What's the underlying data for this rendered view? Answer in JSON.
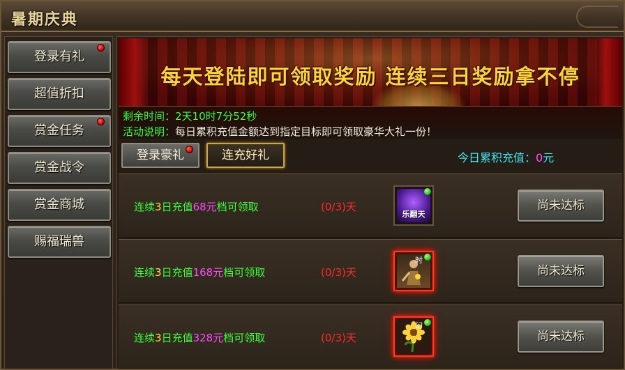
{
  "window": {
    "title": "暑期庆典"
  },
  "sidebar": {
    "items": [
      {
        "label": "登录有礼",
        "badge": true
      },
      {
        "label": "超值折扣",
        "badge": false
      },
      {
        "label": "赏金任务",
        "badge": true
      },
      {
        "label": "赏金战令",
        "badge": false
      },
      {
        "label": "赏金商城",
        "badge": false
      },
      {
        "label": "赐福瑞兽",
        "badge": false
      }
    ]
  },
  "banner": {
    "headline": "每天登陆即可领取奖励 连续三日奖励拿不停"
  },
  "info": {
    "remaining_label": "剩余时间：",
    "remaining_value": "2天10时7分52秒",
    "desc_label": "活动说明：",
    "desc_value": "每日累积充值金额达到指定目标即可领取豪华大礼一份！"
  },
  "tabs": [
    {
      "label": "登录豪礼",
      "badge": true,
      "active": false
    },
    {
      "label": "连充好礼",
      "badge": false,
      "active": true
    }
  ],
  "today_charge": {
    "label": "今日累积充值：",
    "value": "0",
    "unit": "元"
  },
  "rewards": [
    {
      "prefix": "连续",
      "days": "3",
      "mid": "日充值",
      "amount": "68元",
      "suffix": "档可领取",
      "progress": "(0/3)天",
      "item_icon": "carnival-badge-icon",
      "item_text": "乐翻天",
      "button": "尚未达标"
    },
    {
      "prefix": "连续",
      "days": "3",
      "mid": "日充值",
      "amount": "168元",
      "suffix": "档可领取",
      "progress": "(0/3)天",
      "item_icon": "warrior-figure-icon",
      "item_text": "时",
      "button": "尚未达标"
    },
    {
      "prefix": "连续",
      "days": "3",
      "mid": "日充值",
      "amount": "328元",
      "suffix": "档可领取",
      "progress": "(0/3)天",
      "item_icon": "sunflower-icon",
      "item_text": "幻",
      "button": "尚未达标"
    }
  ],
  "colors": {
    "accent_gold": "#ffd23a",
    "text_green": "#3aff3a",
    "text_pink": "#ff4cff",
    "text_red": "#ff2a2a",
    "text_cyan": "#40e8f0"
  }
}
